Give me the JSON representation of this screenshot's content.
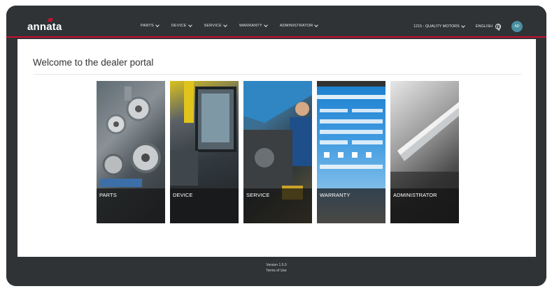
{
  "header": {
    "logo_text": "annata",
    "nav": [
      {
        "label": "PARTS"
      },
      {
        "label": "DEVICE"
      },
      {
        "label": "SERVICE"
      },
      {
        "label": "WARRANTY"
      },
      {
        "label": "ADMINISTRATOR"
      }
    ],
    "company_selector": "1215 : QUALITY MOTORS",
    "language": "ENGLISH",
    "avatar_initials": "AD",
    "accent_color": "#c8102e"
  },
  "main": {
    "title": "Welcome to the dealer portal",
    "tiles": [
      {
        "label": "PARTS",
        "image": "engine-parts-photo"
      },
      {
        "label": "DEVICE",
        "image": "excavator-cab-photo"
      },
      {
        "label": "SERVICE",
        "image": "mechanic-engine-photo"
      },
      {
        "label": "WARRANTY",
        "image": "warranty-claim-form-photo"
      },
      {
        "label": "ADMINISTRATOR",
        "image": "pen-closeup-photo"
      }
    ]
  },
  "footer": {
    "version": "Version 1.5.0",
    "terms": "Terms of Use"
  }
}
